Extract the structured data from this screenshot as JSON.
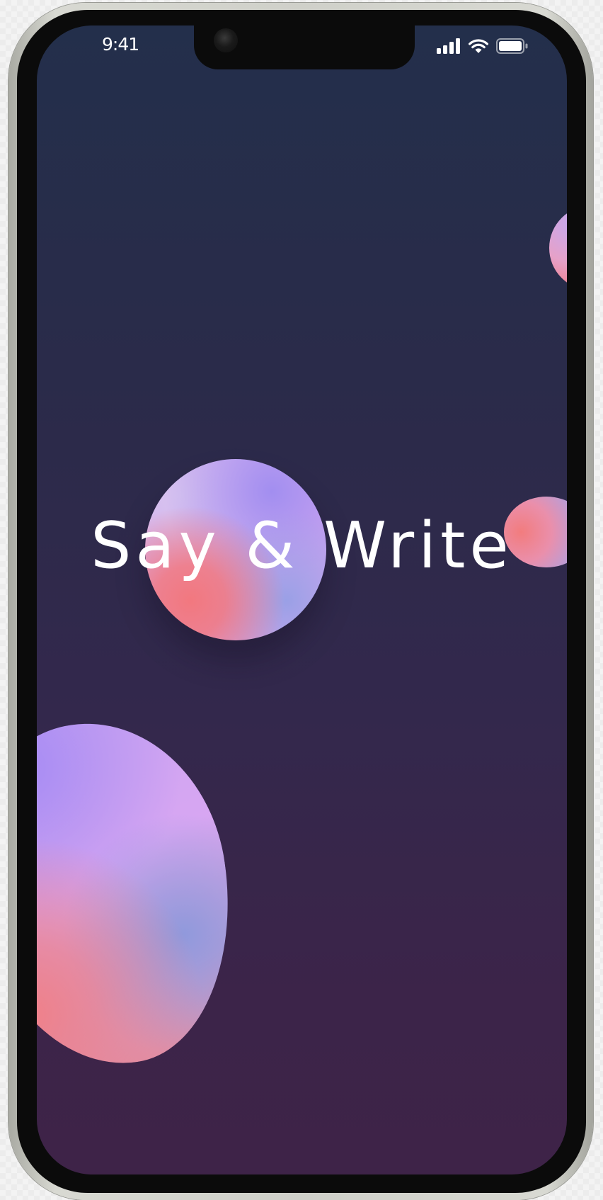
{
  "status_bar": {
    "time": "9:41",
    "icons": [
      "cellular-signal-icon",
      "wifi-icon",
      "battery-icon"
    ]
  },
  "splash": {
    "title": "Say & Write"
  },
  "colors": {
    "background_top": "#232f4b",
    "background_bottom": "#3e2348",
    "blob_pink": "#f2787f",
    "blob_violet": "#a28ef0",
    "blob_lavender": "#d4a8ef",
    "blob_blue": "#9aa0e6",
    "text": "#ffffff"
  }
}
